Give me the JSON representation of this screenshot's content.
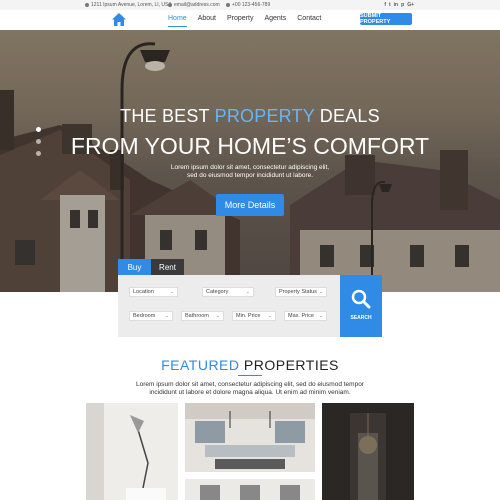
{
  "topbar": {
    "address": "1211 Ipsum Avenue, Lorem, LI, USA",
    "email": "email@address.com",
    "phone": "+00 123-456-789",
    "socials": [
      "f",
      "t",
      "in",
      "p",
      "G+"
    ]
  },
  "nav": {
    "logo_icon": "home-icon",
    "items": [
      "Home",
      "About",
      "Property",
      "Agents",
      "Contact"
    ],
    "active": "Home",
    "submit_label": "SUBMIT PROPERTY"
  },
  "hero": {
    "line1_pre": "THE BEST ",
    "line1_highlight": "PROPERTY",
    "line1_post": " DEALS",
    "line2": "FROM YOUR HOME’S COMFORT",
    "sub1": "Lorem ipsum dolor sit amet, consectetur adipiscing elit,",
    "sub2": "sed do eiusmod tempor incididunt ut labore.",
    "button": "More Details"
  },
  "search": {
    "tabs": [
      "Buy",
      "Rent"
    ],
    "active_tab": "Buy",
    "fields": [
      "Location",
      "Category",
      "Property Status",
      "Bedroom",
      "Bathroom",
      "Min. Price",
      "Max. Price"
    ],
    "button": "SEARCH"
  },
  "featured": {
    "title_highlight": "FEATURED",
    "title_rest": " PROPERTIES",
    "desc1": "Lorem ipsum dolor sit amet, consectetur adipiscing elit, sed do eiusmod tempor",
    "desc2": "incididunt ut labore et dolore magna aliqua. Ut enim ad minim veniam."
  },
  "colors": {
    "accent": "#2f8be6",
    "dark_tab": "#3a3a3a"
  }
}
